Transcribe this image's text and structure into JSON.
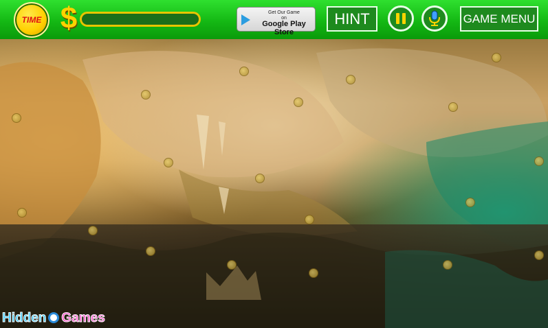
{
  "topbar": {
    "time_label": "TIME",
    "currency_symbol": "$",
    "progress": 0.0,
    "play_store_line1": "Get Our Game",
    "play_store_line2": "on",
    "play_store_line3": "Google Play Store",
    "hint_label": "HINT",
    "menu_label": "GAME MENU"
  },
  "logo": {
    "text": "Hidden Games",
    "part1": "Hidden",
    "part2": "Games"
  },
  "colors": {
    "topbar": "#14b814",
    "accent_yellow": "#ffd200",
    "time_text": "#e01010"
  }
}
